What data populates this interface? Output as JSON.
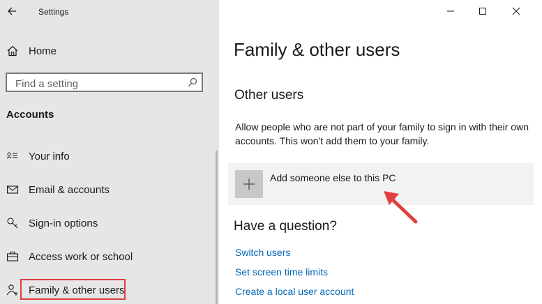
{
  "window": {
    "title": "Settings"
  },
  "sidebar": {
    "home_label": "Home",
    "search": {
      "placeholder": "Find a setting",
      "value": ""
    },
    "section_heading": "Accounts",
    "items": [
      {
        "label": "Your info",
        "icon": "contact-card-icon"
      },
      {
        "label": "Email & accounts",
        "icon": "mail-icon"
      },
      {
        "label": "Sign-in options",
        "icon": "key-icon"
      },
      {
        "label": "Access work or school",
        "icon": "briefcase-icon"
      },
      {
        "label": "Family & other users",
        "icon": "add-person-icon"
      }
    ],
    "selected_item": "Family & other users"
  },
  "main": {
    "title": "Family & other users",
    "other_users": {
      "heading": "Other users",
      "description": "Allow people who are not part of your family to sign in with their own accounts. This won't add them to your family.",
      "add_label": "Add someone else to this PC"
    },
    "question": {
      "heading": "Have a question?",
      "links": [
        "Switch users",
        "Set screen time limits",
        "Create a local user account"
      ]
    }
  },
  "colors": {
    "sidebar_bg": "#e6e6e6",
    "link": "#0067b8",
    "annotation": "#e04040"
  }
}
